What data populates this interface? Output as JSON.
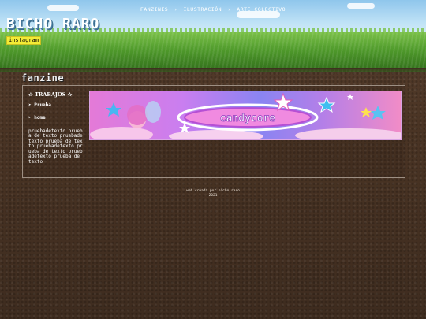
{
  "header": {
    "site_title": "BICHO RARO",
    "instagram_label": "instagram",
    "nav": [
      {
        "label": "FANZINES"
      },
      {
        "label": "ILUSTRACIÓN"
      },
      {
        "label": "ARTE COLECTIVO"
      }
    ],
    "nav_separator": "›"
  },
  "page": {
    "section_title": "fanzine"
  },
  "sidebar": {
    "heading": "☆ TRABAJOS ☆",
    "links": [
      {
        "label": "➤ Prueba"
      },
      {
        "label": "➤ home"
      }
    ],
    "text": "pruebadetexto prueba de texto pruebadetexto prueba de texto pruebadetexto prueba de texto pruebadetexto prueba de texto"
  },
  "banner": {
    "text": "candycore"
  },
  "footer": {
    "line1": "web creada por bicho raro",
    "line2": "2021"
  },
  "colors": {
    "instagram_bg": "#f3ec36",
    "panel_border": "#9d8f83",
    "banner_pink": "#e47ad7",
    "banner_violet": "#8a84f2"
  }
}
